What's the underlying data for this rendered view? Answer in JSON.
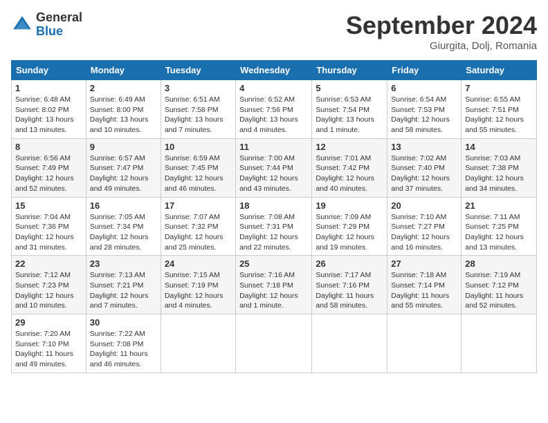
{
  "logo": {
    "general": "General",
    "blue": "Blue"
  },
  "header": {
    "title": "September 2024",
    "location": "Giurgita, Dolj, Romania"
  },
  "weekdays": [
    "Sunday",
    "Monday",
    "Tuesday",
    "Wednesday",
    "Thursday",
    "Friday",
    "Saturday"
  ],
  "weeks": [
    [
      {
        "day": "1",
        "info": "Sunrise: 6:48 AM\nSunset: 8:02 PM\nDaylight: 13 hours\nand 13 minutes."
      },
      {
        "day": "2",
        "info": "Sunrise: 6:49 AM\nSunset: 8:00 PM\nDaylight: 13 hours\nand 10 minutes."
      },
      {
        "day": "3",
        "info": "Sunrise: 6:51 AM\nSunset: 7:58 PM\nDaylight: 13 hours\nand 7 minutes."
      },
      {
        "day": "4",
        "info": "Sunrise: 6:52 AM\nSunset: 7:56 PM\nDaylight: 13 hours\nand 4 minutes."
      },
      {
        "day": "5",
        "info": "Sunrise: 6:53 AM\nSunset: 7:54 PM\nDaylight: 13 hours\nand 1 minute."
      },
      {
        "day": "6",
        "info": "Sunrise: 6:54 AM\nSunset: 7:53 PM\nDaylight: 12 hours\nand 58 minutes."
      },
      {
        "day": "7",
        "info": "Sunrise: 6:55 AM\nSunset: 7:51 PM\nDaylight: 12 hours\nand 55 minutes."
      }
    ],
    [
      {
        "day": "8",
        "info": "Sunrise: 6:56 AM\nSunset: 7:49 PM\nDaylight: 12 hours\nand 52 minutes."
      },
      {
        "day": "9",
        "info": "Sunrise: 6:57 AM\nSunset: 7:47 PM\nDaylight: 12 hours\nand 49 minutes."
      },
      {
        "day": "10",
        "info": "Sunrise: 6:59 AM\nSunset: 7:45 PM\nDaylight: 12 hours\nand 46 minutes."
      },
      {
        "day": "11",
        "info": "Sunrise: 7:00 AM\nSunset: 7:44 PM\nDaylight: 12 hours\nand 43 minutes."
      },
      {
        "day": "12",
        "info": "Sunrise: 7:01 AM\nSunset: 7:42 PM\nDaylight: 12 hours\nand 40 minutes."
      },
      {
        "day": "13",
        "info": "Sunrise: 7:02 AM\nSunset: 7:40 PM\nDaylight: 12 hours\nand 37 minutes."
      },
      {
        "day": "14",
        "info": "Sunrise: 7:03 AM\nSunset: 7:38 PM\nDaylight: 12 hours\nand 34 minutes."
      }
    ],
    [
      {
        "day": "15",
        "info": "Sunrise: 7:04 AM\nSunset: 7:36 PM\nDaylight: 12 hours\nand 31 minutes."
      },
      {
        "day": "16",
        "info": "Sunrise: 7:05 AM\nSunset: 7:34 PM\nDaylight: 12 hours\nand 28 minutes."
      },
      {
        "day": "17",
        "info": "Sunrise: 7:07 AM\nSunset: 7:32 PM\nDaylight: 12 hours\nand 25 minutes."
      },
      {
        "day": "18",
        "info": "Sunrise: 7:08 AM\nSunset: 7:31 PM\nDaylight: 12 hours\nand 22 minutes."
      },
      {
        "day": "19",
        "info": "Sunrise: 7:09 AM\nSunset: 7:29 PM\nDaylight: 12 hours\nand 19 minutes."
      },
      {
        "day": "20",
        "info": "Sunrise: 7:10 AM\nSunset: 7:27 PM\nDaylight: 12 hours\nand 16 minutes."
      },
      {
        "day": "21",
        "info": "Sunrise: 7:11 AM\nSunset: 7:25 PM\nDaylight: 12 hours\nand 13 minutes."
      }
    ],
    [
      {
        "day": "22",
        "info": "Sunrise: 7:12 AM\nSunset: 7:23 PM\nDaylight: 12 hours\nand 10 minutes."
      },
      {
        "day": "23",
        "info": "Sunrise: 7:13 AM\nSunset: 7:21 PM\nDaylight: 12 hours\nand 7 minutes."
      },
      {
        "day": "24",
        "info": "Sunrise: 7:15 AM\nSunset: 7:19 PM\nDaylight: 12 hours\nand 4 minutes."
      },
      {
        "day": "25",
        "info": "Sunrise: 7:16 AM\nSunset: 7:18 PM\nDaylight: 12 hours\nand 1 minute."
      },
      {
        "day": "26",
        "info": "Sunrise: 7:17 AM\nSunset: 7:16 PM\nDaylight: 11 hours\nand 58 minutes."
      },
      {
        "day": "27",
        "info": "Sunrise: 7:18 AM\nSunset: 7:14 PM\nDaylight: 11 hours\nand 55 minutes."
      },
      {
        "day": "28",
        "info": "Sunrise: 7:19 AM\nSunset: 7:12 PM\nDaylight: 11 hours\nand 52 minutes."
      }
    ],
    [
      {
        "day": "29",
        "info": "Sunrise: 7:20 AM\nSunset: 7:10 PM\nDaylight: 11 hours\nand 49 minutes."
      },
      {
        "day": "30",
        "info": "Sunrise: 7:22 AM\nSunset: 7:08 PM\nDaylight: 11 hours\nand 46 minutes."
      },
      {
        "day": "",
        "info": ""
      },
      {
        "day": "",
        "info": ""
      },
      {
        "day": "",
        "info": ""
      },
      {
        "day": "",
        "info": ""
      },
      {
        "day": "",
        "info": ""
      }
    ]
  ]
}
